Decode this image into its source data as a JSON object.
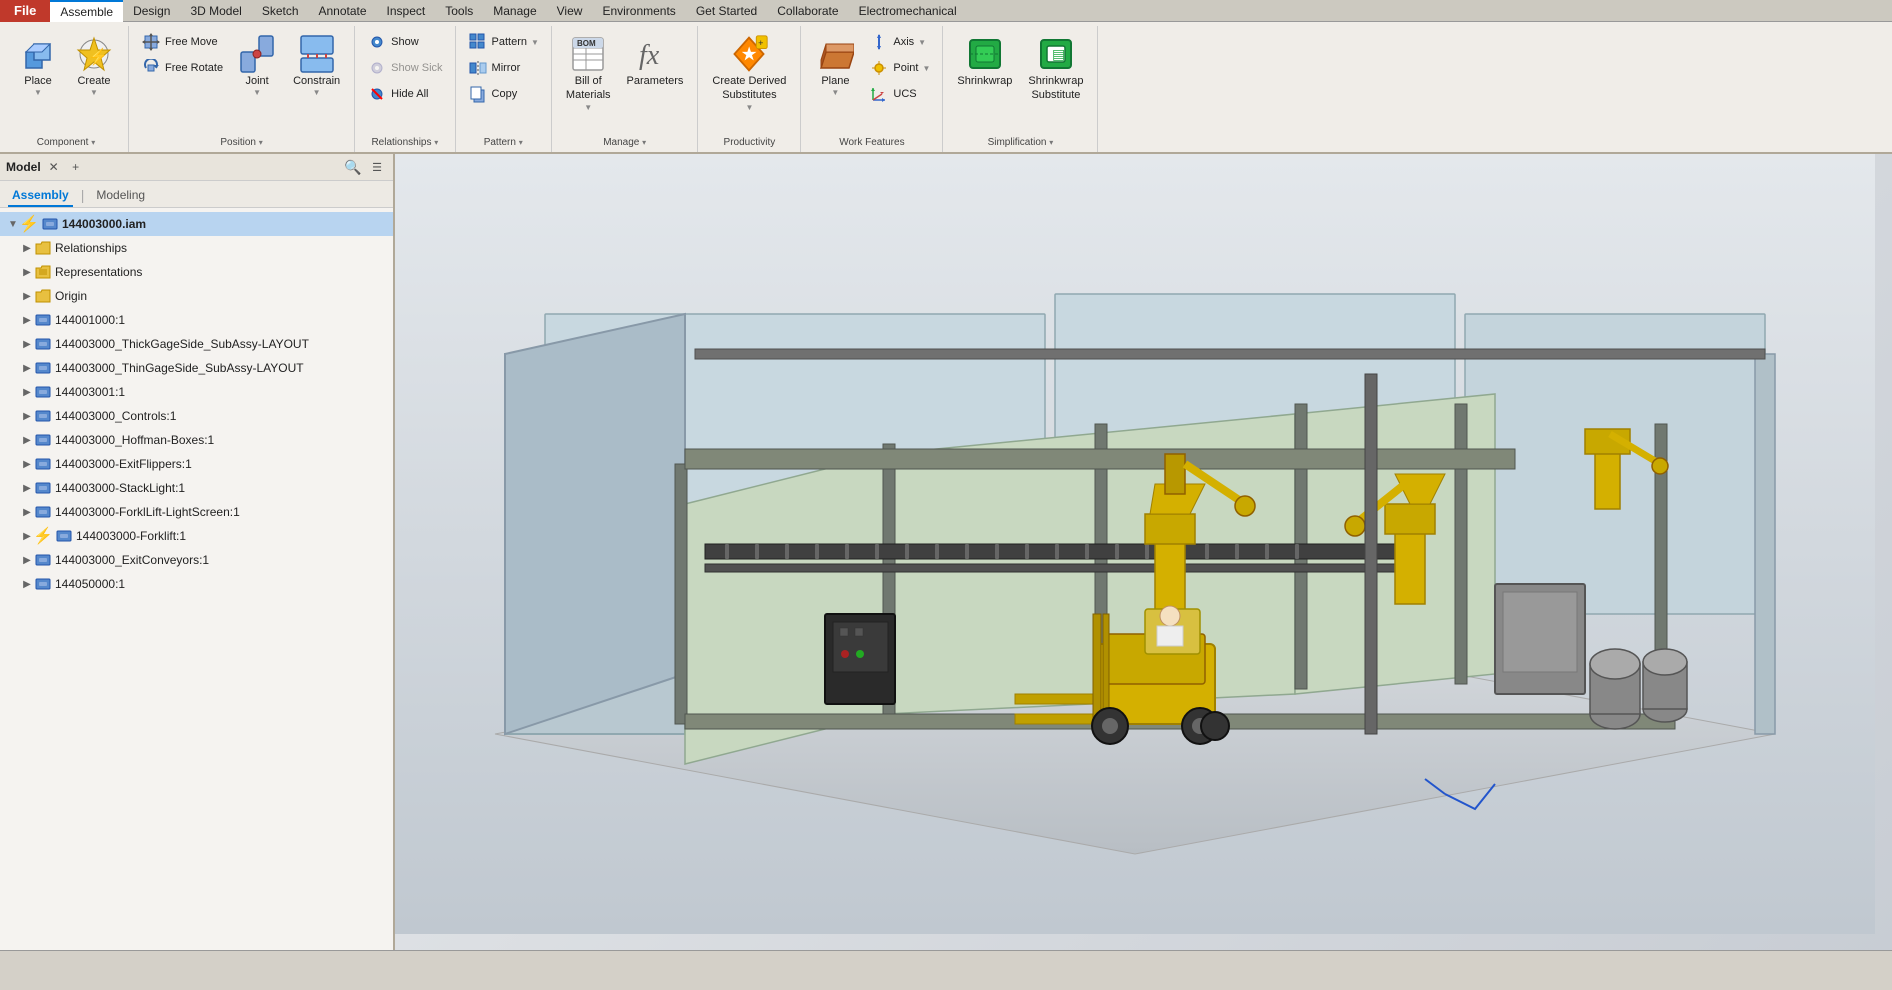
{
  "menubar": {
    "file_label": "File",
    "tabs": [
      {
        "label": "Assemble",
        "active": true
      },
      {
        "label": "Design"
      },
      {
        "label": "3D Model"
      },
      {
        "label": "Sketch"
      },
      {
        "label": "Annotate"
      },
      {
        "label": "Inspect"
      },
      {
        "label": "Tools"
      },
      {
        "label": "Manage"
      },
      {
        "label": "View"
      },
      {
        "label": "Environments"
      },
      {
        "label": "Get Started"
      },
      {
        "label": "Collaborate"
      },
      {
        "label": "Electromechanical"
      }
    ]
  },
  "ribbon": {
    "groups": [
      {
        "id": "component",
        "buttons": [
          {
            "id": "place",
            "label": "Place",
            "size": "large",
            "icon": "📦"
          },
          {
            "id": "create",
            "label": "Create",
            "size": "large",
            "icon": "🔧",
            "badge": "⚡"
          }
        ],
        "footer": "Component",
        "dropdown": true
      },
      {
        "id": "position",
        "buttons": [
          {
            "id": "free-move",
            "label": "Free Move",
            "size": "small",
            "icon": "↕"
          },
          {
            "id": "free-rotate",
            "label": "Free Rotate",
            "size": "small",
            "icon": "↺"
          },
          {
            "id": "joint",
            "label": "Joint",
            "size": "large",
            "icon": "🔗"
          },
          {
            "id": "constrain",
            "label": "Constrain",
            "size": "large",
            "icon": "📐"
          }
        ],
        "footer": "Position",
        "dropdown": true
      },
      {
        "id": "relationships",
        "buttons": [
          {
            "id": "show",
            "label": "Show",
            "size": "small",
            "icon": "👁"
          },
          {
            "id": "show-sick",
            "label": "Show Sick",
            "size": "small",
            "icon": "👁",
            "disabled": true
          },
          {
            "id": "hide-all",
            "label": "Hide All",
            "size": "small",
            "icon": "🙈"
          }
        ],
        "footer": "Relationships",
        "dropdown": true
      },
      {
        "id": "pattern",
        "buttons": [
          {
            "id": "pattern-btn",
            "label": "Pattern",
            "size": "small",
            "icon": "▦"
          },
          {
            "id": "mirror",
            "label": "Mirror",
            "size": "small",
            "icon": "⧖"
          },
          {
            "id": "copy",
            "label": "Copy",
            "size": "small",
            "icon": "📋"
          }
        ],
        "footer": "Pattern",
        "dropdown": true
      },
      {
        "id": "manage",
        "buttons": [
          {
            "id": "bom",
            "label": "Bill of\nMaterials",
            "size": "large",
            "icon": "📋"
          },
          {
            "id": "parameters",
            "label": "Parameters",
            "size": "large",
            "icon": "fx"
          }
        ],
        "footer": "Manage",
        "dropdown": true
      },
      {
        "id": "productivity",
        "buttons": [
          {
            "id": "create-derived",
            "label": "Create Derived\nSubstitutes",
            "size": "large",
            "icon": "🔁"
          }
        ],
        "footer": "Productivity"
      },
      {
        "id": "work-features",
        "buttons": [
          {
            "id": "plane",
            "label": "Plane",
            "size": "large",
            "icon": "▱"
          },
          {
            "id": "axis",
            "label": "Axis",
            "size": "small",
            "icon": "↕",
            "dropdown": true
          },
          {
            "id": "point",
            "label": "Point",
            "size": "small",
            "icon": "·",
            "dropdown": true
          },
          {
            "id": "ucs",
            "label": "UCS",
            "size": "small",
            "icon": "⊕"
          }
        ],
        "footer": "Work Features"
      },
      {
        "id": "simplification",
        "buttons": [
          {
            "id": "shrinkwrap",
            "label": "Shrinkwrap",
            "size": "large",
            "icon": "⬛"
          },
          {
            "id": "shrinkwrap-sub",
            "label": "Shrinkwrap\nSubstitute",
            "size": "large",
            "icon": "⬜"
          }
        ],
        "footer": "Simplification",
        "dropdown": true
      }
    ]
  },
  "panel": {
    "title": "Model",
    "tabs": [
      {
        "label": "Assembly",
        "active": true
      },
      {
        "label": "Modeling"
      }
    ],
    "tree": [
      {
        "id": "root",
        "label": "144003000.iam",
        "indent": 0,
        "icon": "component",
        "bolt": true,
        "bold": true
      },
      {
        "id": "relationships",
        "label": "Relationships",
        "indent": 1,
        "icon": "folder"
      },
      {
        "id": "representations",
        "label": "Representations",
        "indent": 1,
        "icon": "folder-grid"
      },
      {
        "id": "origin",
        "label": "Origin",
        "indent": 1,
        "icon": "folder"
      },
      {
        "id": "c1",
        "label": "144001000:1",
        "indent": 1,
        "icon": "component"
      },
      {
        "id": "c2",
        "label": "144003000_ThickGageSide_SubAssy-LAYOUT",
        "indent": 1,
        "icon": "component"
      },
      {
        "id": "c3",
        "label": "144003000_ThinGageSide_SubAssy-LAYOUT",
        "indent": 1,
        "icon": "component"
      },
      {
        "id": "c4",
        "label": "144003001:1",
        "indent": 1,
        "icon": "component"
      },
      {
        "id": "c5",
        "label": "144003000_Controls:1",
        "indent": 1,
        "icon": "component"
      },
      {
        "id": "c6",
        "label": "144003000_Hoffman-Boxes:1",
        "indent": 1,
        "icon": "component"
      },
      {
        "id": "c7",
        "label": "144003000-ExitFlippers:1",
        "indent": 1,
        "icon": "component"
      },
      {
        "id": "c8",
        "label": "144003000-StackLight:1",
        "indent": 1,
        "icon": "component"
      },
      {
        "id": "c9",
        "label": "144003000-ForklLift-LightScreen:1",
        "indent": 1,
        "icon": "component"
      },
      {
        "id": "c10",
        "label": "144003000-Forklift:1",
        "indent": 1,
        "icon": "component",
        "bolt": true
      },
      {
        "id": "c11",
        "label": "144003000_ExitConveyors:1",
        "indent": 1,
        "icon": "component"
      },
      {
        "id": "c12",
        "label": "144050000:1",
        "indent": 1,
        "icon": "component"
      }
    ]
  },
  "viewport": {
    "background_top": "#e4e8ec",
    "background_bottom": "#c0c8d0"
  },
  "status_bar": {
    "text": ""
  }
}
